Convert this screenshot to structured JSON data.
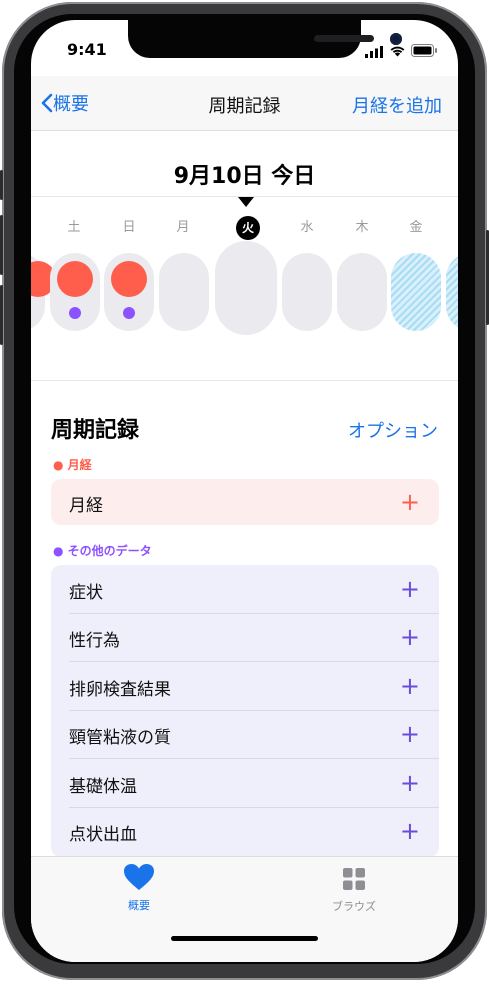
{
  "status_bar": {
    "time": "9:41",
    "signal_icon": "signal-icon",
    "wifi_icon": "wifi-icon",
    "battery_icon": "battery-icon"
  },
  "nav": {
    "back_label": "概要",
    "title": "周期記録",
    "add_label": "月経を追加"
  },
  "date_header": "9月10日 今日",
  "week_days": [
    "土",
    "日",
    "月",
    "火",
    "水",
    "木",
    "金"
  ],
  "section": {
    "title": "周期記録",
    "option_label": "オプション"
  },
  "period_group": {
    "header": "月経",
    "rows": [
      {
        "label": "月経"
      }
    ]
  },
  "other_group": {
    "header": "その他のデータ",
    "rows": [
      {
        "label": "症状"
      },
      {
        "label": "性行為"
      },
      {
        "label": "排卵検査結果"
      },
      {
        "label": "頸管粘液の質"
      },
      {
        "label": "基礎体温"
      },
      {
        "label": "点状出血"
      }
    ]
  },
  "tabs": [
    {
      "label": "概要",
      "icon": "heart-icon",
      "active": true
    },
    {
      "label": "ブラウズ",
      "icon": "grid-icon",
      "active": false
    }
  ],
  "colors": {
    "accent": "#1a73e8",
    "period": "#ff5e4d",
    "other": "#8c52ff",
    "period_bg": "#fdeeed",
    "other_bg": "#efeefb"
  }
}
